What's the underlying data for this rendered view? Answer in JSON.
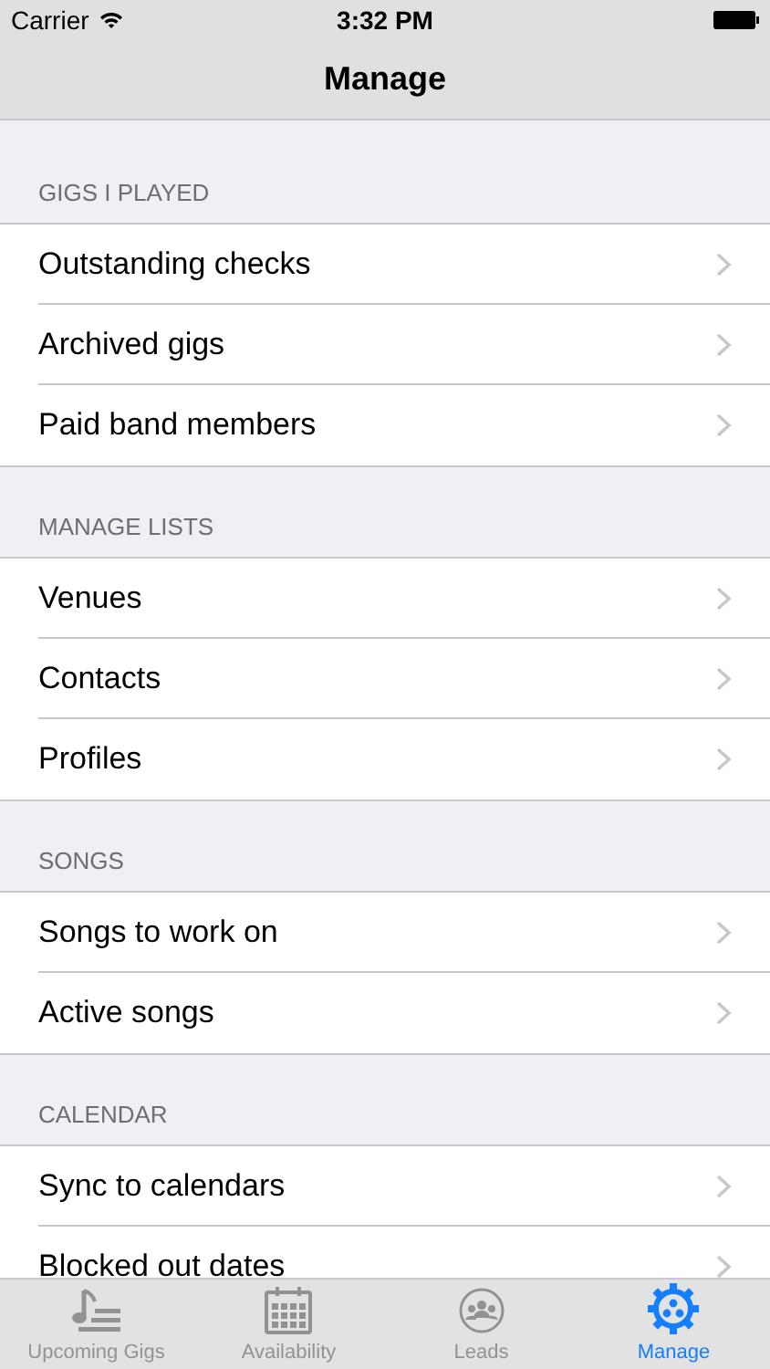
{
  "status_bar": {
    "carrier": "Carrier",
    "time": "3:32 PM"
  },
  "nav_bar": {
    "title": "Manage"
  },
  "sections": [
    {
      "header": "GIGS I PLAYED",
      "rows": [
        "Outstanding checks",
        "Archived gigs",
        "Paid band members"
      ]
    },
    {
      "header": "MANAGE LISTS",
      "rows": [
        "Venues",
        "Contacts",
        "Profiles"
      ]
    },
    {
      "header": "SONGS",
      "rows": [
        "Songs to work on",
        "Active songs"
      ]
    },
    {
      "header": "CALENDAR",
      "rows": [
        "Sync to calendars",
        "Blocked out dates"
      ]
    }
  ],
  "tab_bar": [
    {
      "label": "Upcoming Gigs",
      "kind": "music",
      "selected": false
    },
    {
      "label": "Availability",
      "kind": "calendar",
      "selected": false
    },
    {
      "label": "Leads",
      "kind": "people",
      "selected": false
    },
    {
      "label": "Manage",
      "kind": "gear",
      "selected": true
    }
  ]
}
